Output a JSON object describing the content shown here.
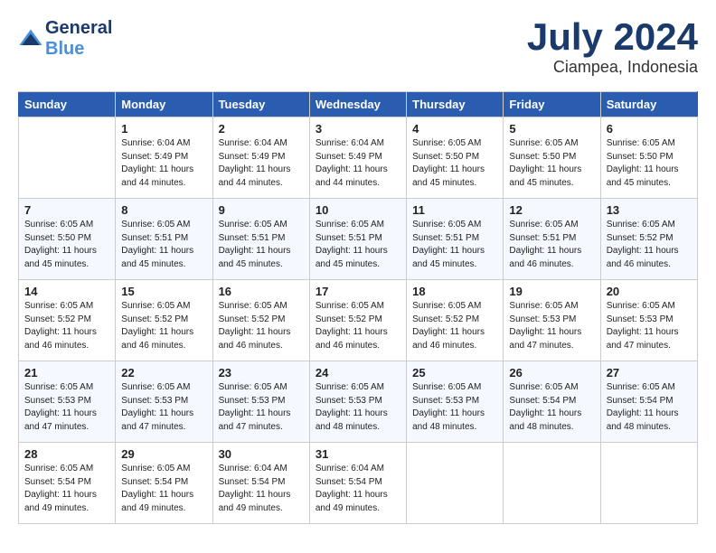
{
  "header": {
    "logo_line1": "General",
    "logo_line2": "Blue",
    "month_title": "July 2024",
    "location": "Ciampea, Indonesia"
  },
  "days_of_week": [
    "Sunday",
    "Monday",
    "Tuesday",
    "Wednesday",
    "Thursday",
    "Friday",
    "Saturday"
  ],
  "weeks": [
    [
      {
        "day": "",
        "info": ""
      },
      {
        "day": "1",
        "info": "Sunrise: 6:04 AM\nSunset: 5:49 PM\nDaylight: 11 hours\nand 44 minutes."
      },
      {
        "day": "2",
        "info": "Sunrise: 6:04 AM\nSunset: 5:49 PM\nDaylight: 11 hours\nand 44 minutes."
      },
      {
        "day": "3",
        "info": "Sunrise: 6:04 AM\nSunset: 5:49 PM\nDaylight: 11 hours\nand 44 minutes."
      },
      {
        "day": "4",
        "info": "Sunrise: 6:05 AM\nSunset: 5:50 PM\nDaylight: 11 hours\nand 45 minutes."
      },
      {
        "day": "5",
        "info": "Sunrise: 6:05 AM\nSunset: 5:50 PM\nDaylight: 11 hours\nand 45 minutes."
      },
      {
        "day": "6",
        "info": "Sunrise: 6:05 AM\nSunset: 5:50 PM\nDaylight: 11 hours\nand 45 minutes."
      }
    ],
    [
      {
        "day": "7",
        "info": "Sunrise: 6:05 AM\nSunset: 5:50 PM\nDaylight: 11 hours\nand 45 minutes."
      },
      {
        "day": "8",
        "info": "Sunrise: 6:05 AM\nSunset: 5:51 PM\nDaylight: 11 hours\nand 45 minutes."
      },
      {
        "day": "9",
        "info": "Sunrise: 6:05 AM\nSunset: 5:51 PM\nDaylight: 11 hours\nand 45 minutes."
      },
      {
        "day": "10",
        "info": "Sunrise: 6:05 AM\nSunset: 5:51 PM\nDaylight: 11 hours\nand 45 minutes."
      },
      {
        "day": "11",
        "info": "Sunrise: 6:05 AM\nSunset: 5:51 PM\nDaylight: 11 hours\nand 45 minutes."
      },
      {
        "day": "12",
        "info": "Sunrise: 6:05 AM\nSunset: 5:51 PM\nDaylight: 11 hours\nand 46 minutes."
      },
      {
        "day": "13",
        "info": "Sunrise: 6:05 AM\nSunset: 5:52 PM\nDaylight: 11 hours\nand 46 minutes."
      }
    ],
    [
      {
        "day": "14",
        "info": "Sunrise: 6:05 AM\nSunset: 5:52 PM\nDaylight: 11 hours\nand 46 minutes."
      },
      {
        "day": "15",
        "info": "Sunrise: 6:05 AM\nSunset: 5:52 PM\nDaylight: 11 hours\nand 46 minutes."
      },
      {
        "day": "16",
        "info": "Sunrise: 6:05 AM\nSunset: 5:52 PM\nDaylight: 11 hours\nand 46 minutes."
      },
      {
        "day": "17",
        "info": "Sunrise: 6:05 AM\nSunset: 5:52 PM\nDaylight: 11 hours\nand 46 minutes."
      },
      {
        "day": "18",
        "info": "Sunrise: 6:05 AM\nSunset: 5:52 PM\nDaylight: 11 hours\nand 46 minutes."
      },
      {
        "day": "19",
        "info": "Sunrise: 6:05 AM\nSunset: 5:53 PM\nDaylight: 11 hours\nand 47 minutes."
      },
      {
        "day": "20",
        "info": "Sunrise: 6:05 AM\nSunset: 5:53 PM\nDaylight: 11 hours\nand 47 minutes."
      }
    ],
    [
      {
        "day": "21",
        "info": "Sunrise: 6:05 AM\nSunset: 5:53 PM\nDaylight: 11 hours\nand 47 minutes."
      },
      {
        "day": "22",
        "info": "Sunrise: 6:05 AM\nSunset: 5:53 PM\nDaylight: 11 hours\nand 47 minutes."
      },
      {
        "day": "23",
        "info": "Sunrise: 6:05 AM\nSunset: 5:53 PM\nDaylight: 11 hours\nand 47 minutes."
      },
      {
        "day": "24",
        "info": "Sunrise: 6:05 AM\nSunset: 5:53 PM\nDaylight: 11 hours\nand 48 minutes."
      },
      {
        "day": "25",
        "info": "Sunrise: 6:05 AM\nSunset: 5:53 PM\nDaylight: 11 hours\nand 48 minutes."
      },
      {
        "day": "26",
        "info": "Sunrise: 6:05 AM\nSunset: 5:54 PM\nDaylight: 11 hours\nand 48 minutes."
      },
      {
        "day": "27",
        "info": "Sunrise: 6:05 AM\nSunset: 5:54 PM\nDaylight: 11 hours\nand 48 minutes."
      }
    ],
    [
      {
        "day": "28",
        "info": "Sunrise: 6:05 AM\nSunset: 5:54 PM\nDaylight: 11 hours\nand 49 minutes."
      },
      {
        "day": "29",
        "info": "Sunrise: 6:05 AM\nSunset: 5:54 PM\nDaylight: 11 hours\nand 49 minutes."
      },
      {
        "day": "30",
        "info": "Sunrise: 6:04 AM\nSunset: 5:54 PM\nDaylight: 11 hours\nand 49 minutes."
      },
      {
        "day": "31",
        "info": "Sunrise: 6:04 AM\nSunset: 5:54 PM\nDaylight: 11 hours\nand 49 minutes."
      },
      {
        "day": "",
        "info": ""
      },
      {
        "day": "",
        "info": ""
      },
      {
        "day": "",
        "info": ""
      }
    ]
  ]
}
